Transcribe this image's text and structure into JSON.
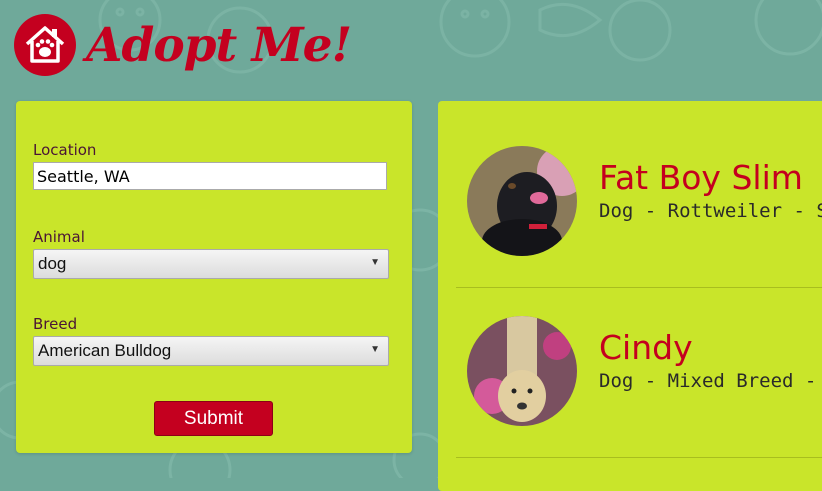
{
  "header": {
    "logo_text": "Adopt Me!"
  },
  "search": {
    "location_label": "Location",
    "location_value": "Seattle, WA",
    "animal_label": "Animal",
    "animal_value": "dog",
    "breed_label": "Breed",
    "breed_value": "American Bulldog",
    "submit_label": "Submit"
  },
  "results": [
    {
      "name": "Fat Boy Slim",
      "description": "Dog - Rottweiler - St"
    },
    {
      "name": "Cindy",
      "description": "Dog - Mixed Breed -"
    }
  ],
  "colors": {
    "background": "#6fa99a",
    "panel": "#c9e52a",
    "accent": "#c4001f"
  }
}
